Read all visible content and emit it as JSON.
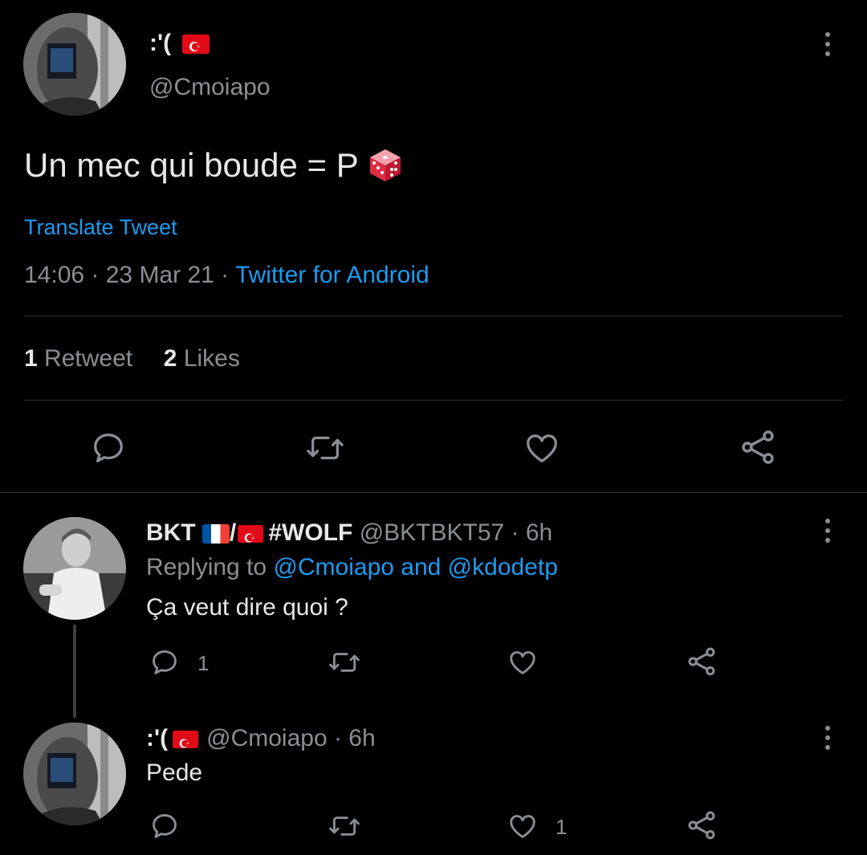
{
  "main_tweet": {
    "display_name": ":'(",
    "handle": "@Cmoiapo",
    "text": "Un mec qui boude = P",
    "text_emoji": "game-die",
    "translate": "Translate Tweet",
    "time": "14:06 · 23 Mar 21 · ",
    "source": "Twitter for Android",
    "retweet_count": "1",
    "retweet_label": "Retweet",
    "likes_count": "2",
    "likes_label": "Likes"
  },
  "replies": [
    {
      "display_name": "BKT",
      "name_sep": "/",
      "name_tag": "#WOLF",
      "handle": "@BKTBKT57",
      "time": " · 6h",
      "replying_prefix": "Replying to ",
      "replying_to": "@Cmoiapo and @kdodetp",
      "text": "Ça veut dire quoi ?",
      "reply_count": "1",
      "like_count": ""
    },
    {
      "display_name": ":'(",
      "handle": "@Cmoiapo",
      "time": " · 6h",
      "text": "Pede",
      "reply_count": "",
      "like_count": "1"
    }
  ],
  "colors": {
    "background": "#000000",
    "link_blue": "#1d9bf0",
    "muted": "#8b8f94",
    "flag_red": "#e30a17"
  }
}
